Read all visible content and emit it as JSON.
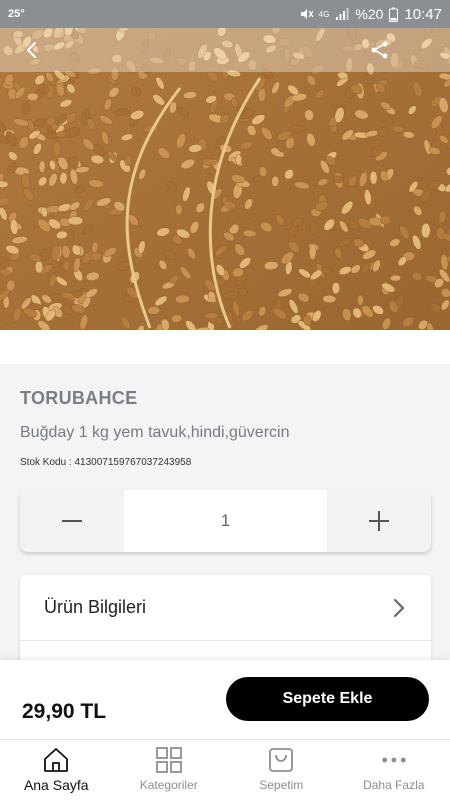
{
  "status_bar": {
    "temperature": "25°",
    "network": "4G",
    "battery_percent": "%20",
    "time": "10:47"
  },
  "header": {
    "back_icon": "chevron-left-icon",
    "share_icon": "share-icon"
  },
  "product": {
    "image_desc": "wheat-grains-photo",
    "brand": "TORUBAHCE",
    "name": "Buğday 1 kg yem tavuk,hindi,güvercin",
    "stock_code": "Stok Kodu : 4130071597670372439​58"
  },
  "quantity": {
    "value": "1",
    "minus_icon": "minus-icon",
    "plus_icon": "plus-icon"
  },
  "info": {
    "product_info_label": "Ürün Bilgileri"
  },
  "purchase": {
    "price": "29,90 TL",
    "add_to_cart_label": "Sepete Ekle"
  },
  "bottom_nav": {
    "items": [
      {
        "label": "Ana Sayfa",
        "icon": "home-icon",
        "active": true
      },
      {
        "label": "Kategoriler",
        "icon": "grid-icon",
        "active": false
      },
      {
        "label": "Sepetim",
        "icon": "cart-icon",
        "active": false
      },
      {
        "label": "Daha Fazla",
        "icon": "more-icon",
        "active": false
      }
    ]
  },
  "colors": {
    "status_bar": "#8a8f94",
    "accent_button": "#000000",
    "brand_text": "#7a7f85"
  }
}
